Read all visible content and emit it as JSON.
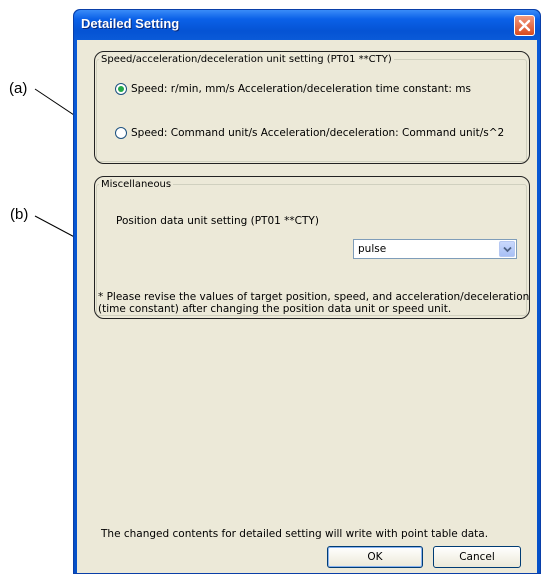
{
  "callouts": {
    "a": "(a)",
    "b": "(b)"
  },
  "window": {
    "title": "Detailed Setting"
  },
  "group_unit": {
    "legend": "Speed/acceleration/deceleration unit setting (PT01 **CTY)",
    "options": [
      {
        "label": "Speed: r/min, mm/s  Acceleration/deceleration time constant: ms",
        "selected": true
      },
      {
        "label": "Speed: Command unit/s  Acceleration/deceleration: Command unit/s^2",
        "selected": false
      }
    ]
  },
  "group_misc": {
    "legend": "Miscellaneous",
    "position_label": "Position data unit setting (PT01 **CTY)",
    "position_value": "pulse",
    "note_line1": "* Please revise the values of target position, speed, and acceleration/deceleration",
    "note_line2": "(time constant) after changing the position data unit or speed unit."
  },
  "footer": {
    "message": "The changed contents for detailed setting will write with point table data.",
    "ok_label": "OK",
    "cancel_label": "Cancel"
  },
  "colors": {
    "title_bar": "#0553d4",
    "close_button": "#d94b1f",
    "client": "#ece9d8"
  }
}
